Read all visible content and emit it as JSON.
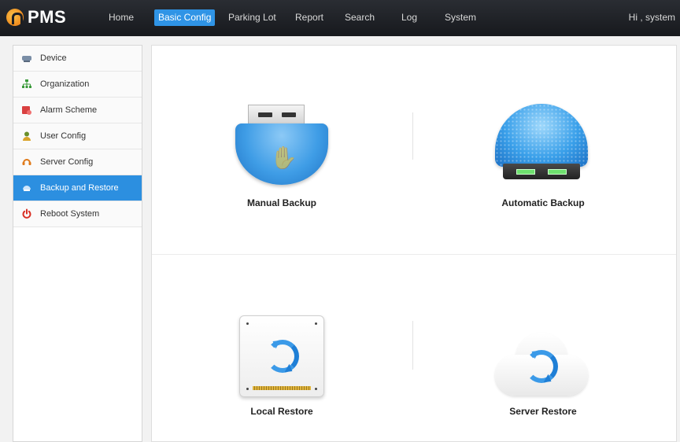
{
  "app": {
    "name": "PMS"
  },
  "nav": {
    "items": [
      {
        "label": "Home"
      },
      {
        "label": "Basic Config",
        "active": true
      },
      {
        "label": "Parking Lot"
      },
      {
        "label": "Report"
      },
      {
        "label": "Search"
      },
      {
        "label": "Log"
      },
      {
        "label": "System"
      }
    ],
    "greeting": "Hi , system"
  },
  "sidebar": {
    "items": [
      {
        "label": "Device",
        "icon": "device-icon"
      },
      {
        "label": "Organization",
        "icon": "organization-icon"
      },
      {
        "label": "Alarm Scheme",
        "icon": "alarm-icon"
      },
      {
        "label": "User Config",
        "icon": "user-icon"
      },
      {
        "label": "Server Config",
        "icon": "server-icon"
      },
      {
        "label": "Backup and Restore",
        "icon": "backup-icon",
        "active": true
      },
      {
        "label": "Reboot System",
        "icon": "power-icon"
      }
    ]
  },
  "main": {
    "tiles": [
      {
        "label": "Manual Backup",
        "icon": "usb-drive-icon"
      },
      {
        "label": "Automatic Backup",
        "icon": "auto-backup-icon"
      },
      {
        "label": "Local Restore",
        "icon": "local-drive-restore-icon"
      },
      {
        "label": "Server Restore",
        "icon": "cloud-restore-icon"
      }
    ]
  },
  "colors": {
    "topbar": "#1d1f23",
    "accent": "#2f94e6",
    "sidebar_active": "#2c8fe0"
  }
}
